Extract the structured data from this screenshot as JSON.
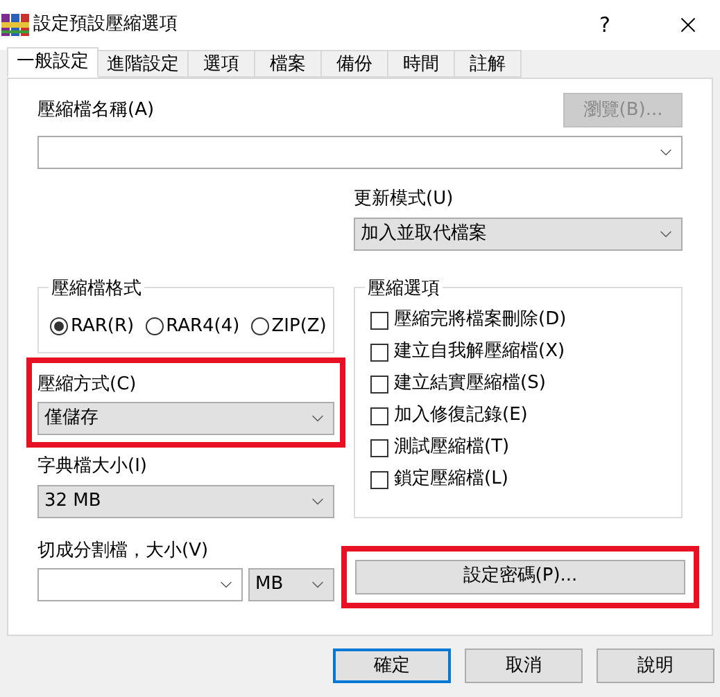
{
  "window": {
    "title": "設定預設壓縮選項",
    "help": "?"
  },
  "tabs": [
    {
      "label": "一般設定",
      "selected": true
    },
    {
      "label": "進階設定",
      "selected": false
    },
    {
      "label": "選項",
      "selected": false
    },
    {
      "label": "檔案",
      "selected": false
    },
    {
      "label": "備份",
      "selected": false
    },
    {
      "label": "時間",
      "selected": false
    },
    {
      "label": "註解",
      "selected": false
    }
  ],
  "archive_name": {
    "label": "壓縮檔名稱(A)",
    "browse_button": {
      "label": "瀏覽(B)...",
      "disabled": true
    }
  },
  "update_mode": {
    "label": "更新模式(U)",
    "value": "加入並取代檔案"
  },
  "archive_format": {
    "title": "壓縮檔格式",
    "options": [
      {
        "label": "RAR(R)",
        "selected": true
      },
      {
        "label": "RAR4(4)",
        "selected": false
      },
      {
        "label": "ZIP(Z)",
        "selected": false
      }
    ]
  },
  "compression_method": {
    "label": "壓縮方式(C)",
    "value": "僅儲存",
    "highlighted": true
  },
  "dictionary_size": {
    "label": "字典檔大小(I)",
    "value": "32 MB"
  },
  "split": {
    "label": "切成分割檔，大小(V)",
    "unit": "MB"
  },
  "archive_options": {
    "title": "壓縮選項",
    "options": [
      {
        "label": "壓縮完將檔案刪除(D)",
        "checked": false
      },
      {
        "label": "建立自我解壓縮檔(X)",
        "checked": false
      },
      {
        "label": "建立結實壓縮檔(S)",
        "checked": false
      },
      {
        "label": "加入修復記錄(E)",
        "checked": false
      },
      {
        "label": "測試壓縮檔(T)",
        "checked": false
      },
      {
        "label": "鎖定壓縮檔(L)",
        "checked": false
      }
    ]
  },
  "password_button": {
    "label": "設定密碼(P)...",
    "highlighted": true
  },
  "buttons": [
    {
      "label": "確定",
      "default": true
    },
    {
      "label": "取消",
      "default": false
    },
    {
      "label": "說明",
      "default": false
    }
  ]
}
